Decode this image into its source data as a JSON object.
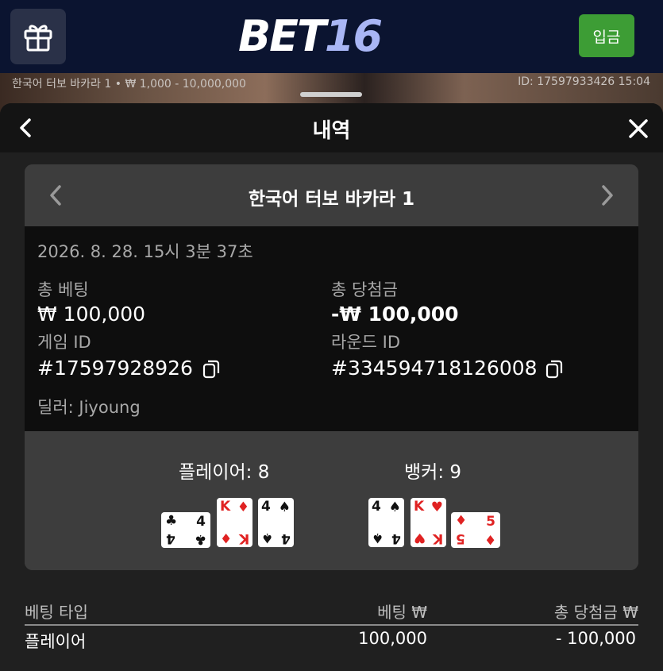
{
  "header": {
    "logo_part1": "BET",
    "logo_part2": "16",
    "deposit_label": "입금"
  },
  "stream": {
    "info": "한국어 터보 바카라 1 • ₩ 1,000 - 10,000,000",
    "id": "ID: 17597933426 15:04"
  },
  "sheet": {
    "title": "내역"
  },
  "round": {
    "game_name": "한국어 터보 바카라 1",
    "datetime": "2026. 8. 28. 15시 3분 37초",
    "total_bet_label": "총 베팅",
    "total_bet_value": "₩ 100,000",
    "total_win_label": "총 당첨금",
    "total_win_value": "-₩ 100,000",
    "game_id_label": "게임 ID",
    "game_id_value": "#17597928926",
    "round_id_label": "라운드 ID",
    "round_id_value": "#334594718126008",
    "dealer": "딜러: Jiyoung"
  },
  "result": {
    "player_label": "플레이어: 8",
    "banker_label": "뱅커: 9",
    "player_cards": [
      {
        "rank": "4",
        "suit": "♣",
        "color": "#111111",
        "rotated": true
      },
      {
        "rank": "K",
        "suit": "♦",
        "color": "#e02222",
        "rotated": false
      },
      {
        "rank": "4",
        "suit": "♠",
        "color": "#111111",
        "rotated": false
      }
    ],
    "banker_cards": [
      {
        "rank": "4",
        "suit": "♠",
        "color": "#111111",
        "rotated": false
      },
      {
        "rank": "K",
        "suit": "♥",
        "color": "#e02222",
        "rotated": false
      },
      {
        "rank": "5",
        "suit": "♦",
        "color": "#e02222",
        "rotated": true
      }
    ]
  },
  "bets_table": {
    "headers": [
      "베팅 타입",
      "베팅 ₩",
      "총 당첨금 ₩"
    ],
    "rows": [
      {
        "type": "플레이어",
        "bet": "100,000",
        "win": "- 100,000"
      }
    ]
  },
  "colors": {
    "deposit_green": "#3d9d35",
    "topbar_navy": "#0b1430",
    "logo_accent": "#a9b6f5",
    "card_red": "#e02222"
  }
}
